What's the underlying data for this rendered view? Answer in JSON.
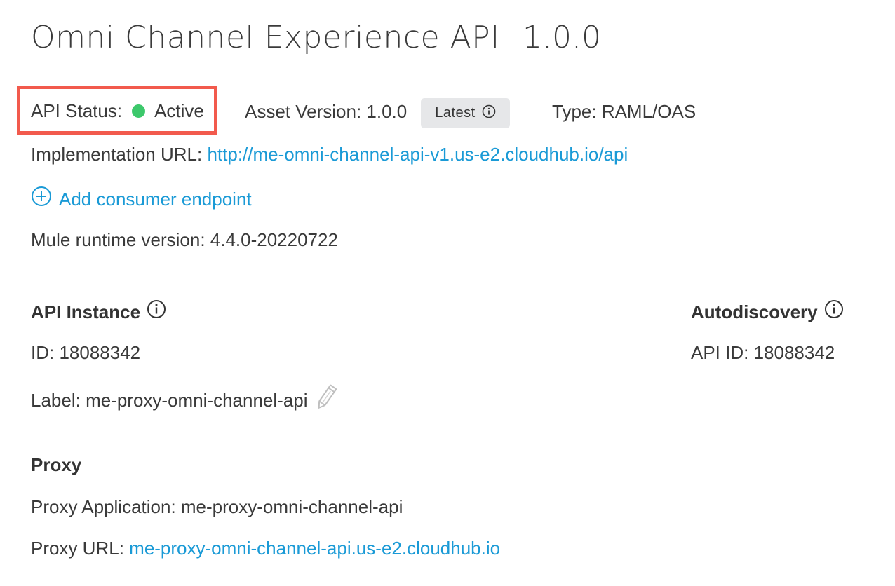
{
  "header": {
    "title": "Omni Channel Experience API",
    "version": "1.0.0"
  },
  "status": {
    "label": "API Status:",
    "value": "Active",
    "color": "#3cc86b",
    "highlight_color": "#f25a4d"
  },
  "asset_version": {
    "label": "Asset Version: 1.0.0",
    "badge": "Latest",
    "badge_icon": "info-icon"
  },
  "type": {
    "label": "Type: RAML/OAS"
  },
  "implementation": {
    "label": "Implementation URL:",
    "url": "http://me-omni-channel-api-v1.us-e2.cloudhub.io/api"
  },
  "consumer_endpoint": {
    "icon": "plus-circle-icon",
    "label": "Add consumer endpoint"
  },
  "runtime": {
    "label": "Mule runtime version: 4.4.0-20220722"
  },
  "api_instance": {
    "heading": "API Instance",
    "heading_icon": "info-icon",
    "id": "ID: 18088342",
    "label": "Label: me-proxy-omni-channel-api",
    "edit_icon": "pencil-icon"
  },
  "autodiscovery": {
    "heading": "Autodiscovery",
    "heading_icon": "info-icon",
    "api_id": "API ID: 18088342"
  },
  "proxy": {
    "heading": "Proxy",
    "application": "Proxy Application: me-proxy-omni-channel-api",
    "url_label": "Proxy URL:",
    "url": "me-proxy-omni-channel-api.us-e2.cloudhub.io"
  },
  "colors": {
    "link": "#1a9ad6",
    "text": "#3a3a3a",
    "badge_bg": "#e6e7e9"
  }
}
